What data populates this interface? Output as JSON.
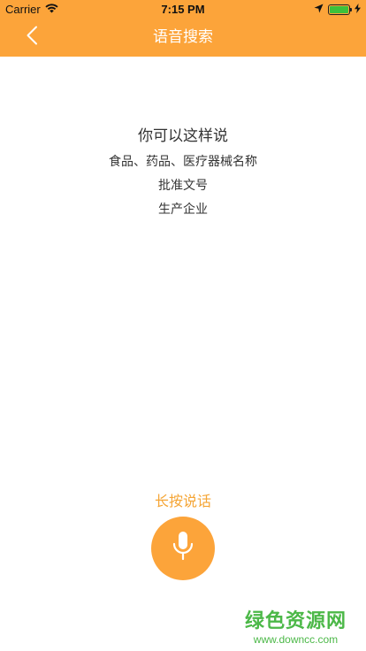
{
  "status": {
    "carrier": "Carrier",
    "time": "7:15 PM",
    "battery_level": 1.0
  },
  "header": {
    "title": "语音搜索",
    "back_icon": "chevron-left-icon",
    "background_color": "#FCA43A"
  },
  "hints": {
    "title": "你可以这样说",
    "lines": [
      "食品、药品、医疗器械名称",
      "批准文号",
      "生产企业"
    ]
  },
  "voice": {
    "label": "长按说话",
    "mic_icon": "microphone-icon",
    "accent_color": "#FCA43A"
  },
  "watermark": {
    "text": "绿色资源网",
    "url": "www.downcc.com"
  }
}
